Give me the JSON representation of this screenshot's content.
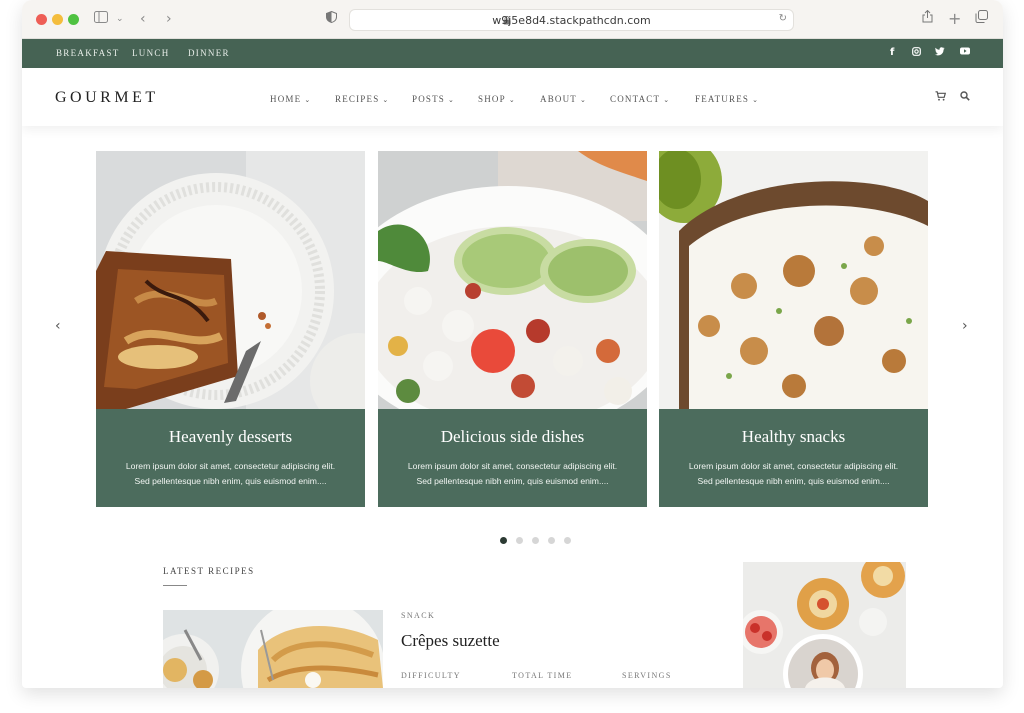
{
  "browser": {
    "url": "w9j5e8d4.stackpathcdn.com"
  },
  "topbar": {
    "meals": [
      "BREAKFAST",
      "LUNCH",
      "DINNER"
    ],
    "social_icons": [
      "facebook-icon",
      "instagram-icon",
      "twitter-icon",
      "youtube-icon"
    ]
  },
  "nav": {
    "logo": "GOURMET",
    "items": [
      "HOME",
      "RECIPES",
      "POSTS",
      "SHOP",
      "ABOUT",
      "CONTACT",
      "FEATURES"
    ]
  },
  "carousel": {
    "cards": [
      {
        "title": "Heavenly desserts",
        "line1": "Lorem ipsum dolor sit amet, consectetur adipiscing elit.",
        "line2": "Sed pellentesque nibh enim, quis euismod enim...."
      },
      {
        "title": "Delicious side dishes",
        "line1": "Lorem ipsum dolor sit amet, consectetur adipiscing elit.",
        "line2": "Sed pellentesque nibh enim, quis euismod enim...."
      },
      {
        "title": "Healthy snacks",
        "line1": "Lorem ipsum dolor sit amet, consectetur adipiscing elit.",
        "line2": "Sed pellentesque nibh enim, quis euismod enim...."
      }
    ],
    "slide_count": 5,
    "active_slide": 1
  },
  "latest": {
    "title": "LATEST RECIPES",
    "recipe": {
      "category": "SNACK",
      "title": "Crêpes suzette",
      "meta": [
        "DIFFICULTY",
        "TOTAL TIME",
        "SERVINGS"
      ]
    }
  },
  "colors": {
    "brand_green": "#466354",
    "panel_green": "#4c6c5d",
    "active_dot": "#2c3a33"
  }
}
